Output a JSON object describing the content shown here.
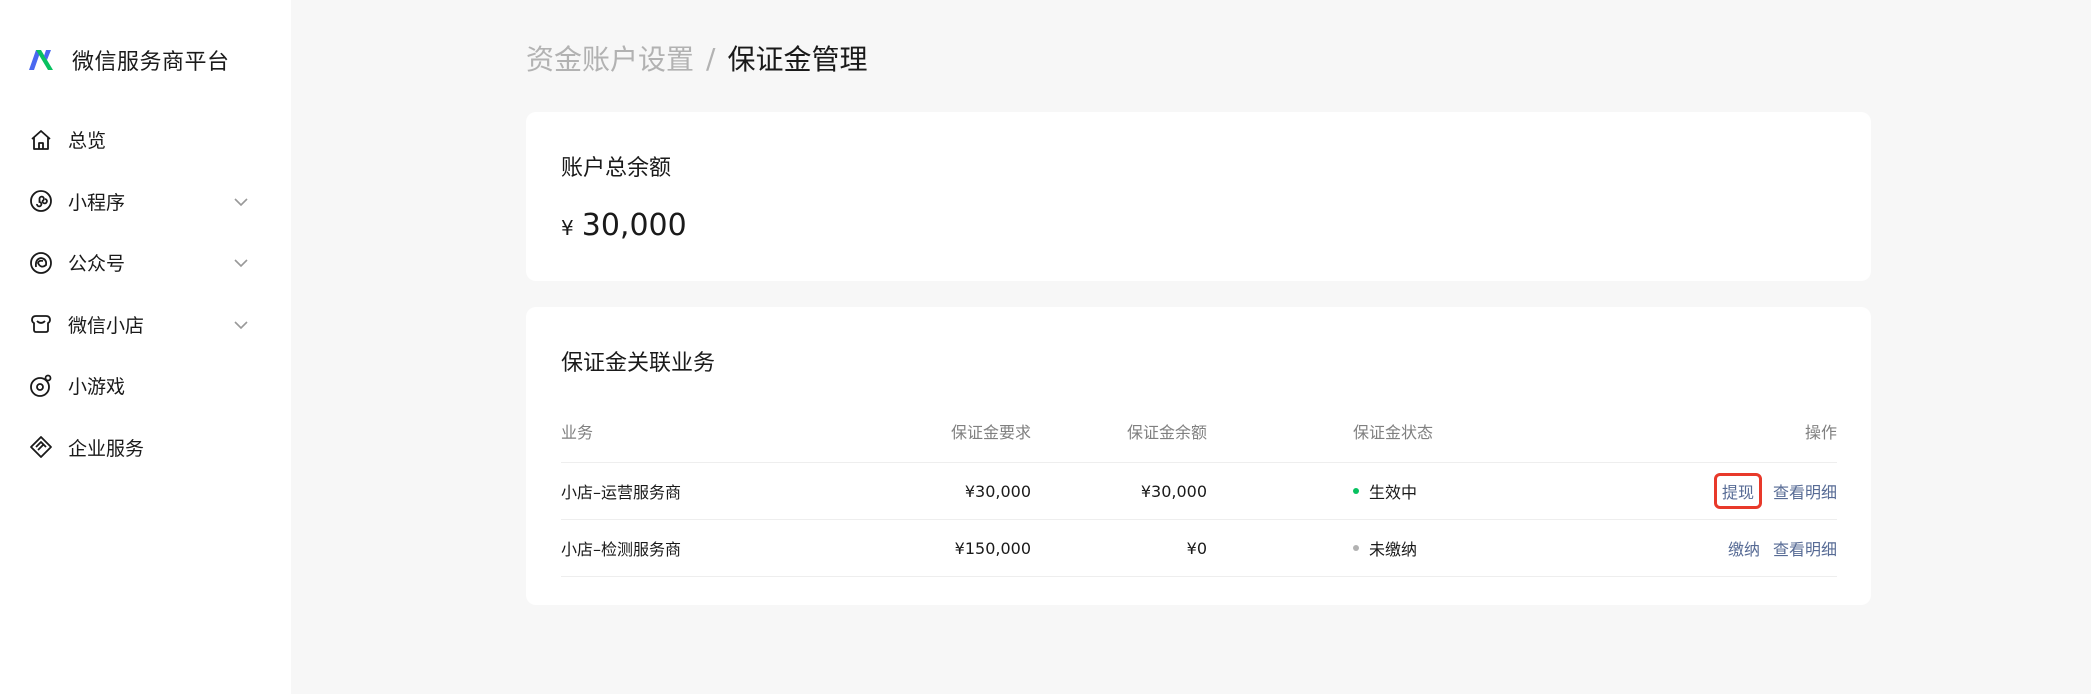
{
  "brand": {
    "name": "微信服务商平台",
    "logo": "wechat-service-logo",
    "colors": {
      "green": "#07c160",
      "blue": "#4a68f0"
    }
  },
  "sidebar": {
    "items": [
      {
        "label": "总览",
        "icon": "home-icon",
        "has_submenu": false
      },
      {
        "label": "小程序",
        "icon": "mini-program-icon",
        "has_submenu": true
      },
      {
        "label": "公众号",
        "icon": "official-account-icon",
        "has_submenu": true
      },
      {
        "label": "微信小店",
        "icon": "wechat-store-icon",
        "has_submenu": true
      },
      {
        "label": "小游戏",
        "icon": "mini-game-icon",
        "has_submenu": false
      },
      {
        "label": "企业服务",
        "icon": "enterprise-service-icon",
        "has_submenu": false
      }
    ]
  },
  "breadcrumb": {
    "parent": "资金账户设置",
    "separator": "/",
    "current": "保证金管理"
  },
  "balance_card": {
    "title": "账户总余额",
    "currency": "¥",
    "amount": "30,000"
  },
  "business_card": {
    "title": "保证金关联业务",
    "columns": {
      "business": "业务",
      "requirement": "保证金要求",
      "balance": "保证金余额",
      "status": "保证金状态",
      "operations": "操作"
    },
    "rows": [
      {
        "business": "小店–运营服务商",
        "requirement": "¥30,000",
        "balance": "¥30,000",
        "status": "生效中",
        "status_color": "#07c160",
        "op1": "提现",
        "op2": "查看明细",
        "op1_highlighted": true
      },
      {
        "business": "小店–检测服务商",
        "requirement": "¥150,000",
        "balance": "¥0",
        "status": "未缴纳",
        "status_color": "#b2b2b2",
        "op1": "缴纳",
        "op2": "查看明细",
        "op1_highlighted": false
      }
    ]
  },
  "colors": {
    "link": "#576b95",
    "highlight_border": "#e8392a"
  }
}
